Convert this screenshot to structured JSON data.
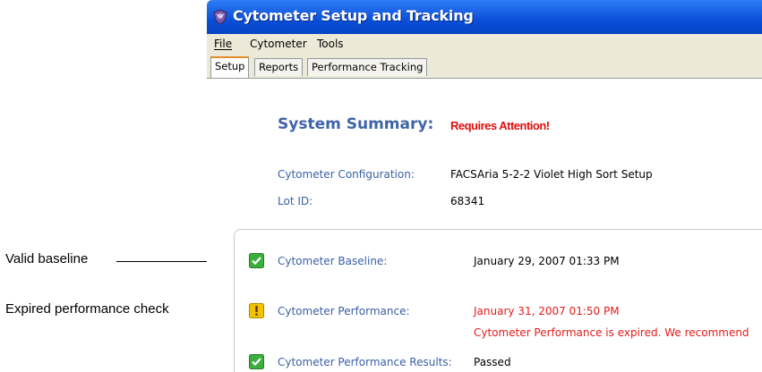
{
  "window": {
    "title": "Cytometer Setup and Tracking"
  },
  "menu": {
    "file": "File",
    "cytometer": "Cytometer",
    "tools": "Tools"
  },
  "tabs": {
    "setup": "Setup",
    "reports": "Reports",
    "performance": "Performance Tracking"
  },
  "summary": {
    "title": "System Summary:",
    "status": "Requires Attention!"
  },
  "config": {
    "config_label": "Cytometer Configuration:",
    "config_value": "FACSAria 5-2-2 Violet High Sort Setup",
    "lot_label": "Lot ID:",
    "lot_value": "68341"
  },
  "checks": {
    "baseline_label": "Cytometer Baseline:",
    "baseline_value": "January 29, 2007 01:33 PM",
    "baseline_icon": "check-icon",
    "performance_label": "Cytometer Performance:",
    "performance_value": "January 31, 2007 01:50 PM",
    "performance_message": "Cytometer Performance is expired. We recommend",
    "performance_icon": "warning-icon",
    "results_label": "Cytometer Performance Results:",
    "results_value": "Passed",
    "results_icon": "check-icon"
  },
  "callouts": {
    "valid": "Valid baseline",
    "expired": "Expired performance check"
  },
  "colors": {
    "title_bar": "#0a4fd8",
    "attention": "#e10e0e",
    "label_blue": "#3a60a6",
    "ok_green": "#3cae3c",
    "warn_yellow": "#f2c200"
  }
}
